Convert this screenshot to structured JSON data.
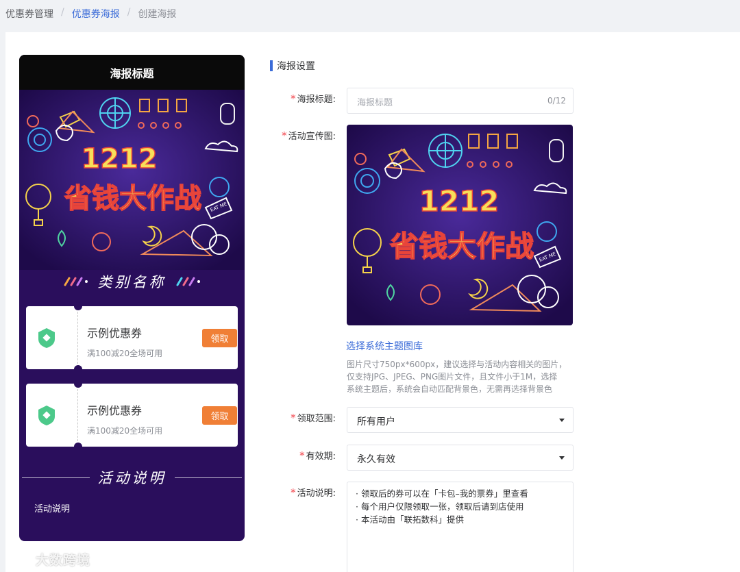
{
  "breadcrumb": {
    "items": [
      "优惠券管理",
      "优惠券海报",
      "创建海报"
    ],
    "separator": "/"
  },
  "poster": {
    "header_title": "海报标题",
    "banner": {
      "line1": "1212",
      "line2": "省钱大作战",
      "sign": "EAT ME"
    },
    "category_title": "类别名称",
    "coupons": [
      {
        "title": "示例优惠券",
        "desc": "满100减20全场可用",
        "button": "领取"
      },
      {
        "title": "示例优惠券",
        "desc": "满100减20全场可用",
        "button": "领取"
      }
    ],
    "activity_title": "活动说明",
    "activity_text": "活动说明"
  },
  "settings": {
    "section_title": "海报设置",
    "fields": {
      "title": {
        "label": "海报标题:",
        "placeholder": "海报标题",
        "counter": "0/12"
      },
      "promo_image": {
        "label": "活动宣传图:"
      },
      "theme_link": "选择系统主题图库",
      "hint_lines": [
        "图片尺寸750px*600px，建议选择与活动内容相关的图片，",
        "仅支持JPG、JPEG、PNG图片文件，且文件小于1M，选择",
        "系统主题后，系统会自动匹配背景色，无需再选择背景色"
      ],
      "scope": {
        "label": "领取范围:",
        "value": "所有用户"
      },
      "validity": {
        "label": "有效期:",
        "value": "永久有效"
      },
      "description": {
        "label": "活动说明:",
        "lines": [
          "· 领取后的券可以在「卡包–我的票券」里查看",
          "· 每个用户仅限领取一张，领取后请到店使用",
          "· 本活动由「联拓数科」提供"
        ]
      }
    }
  },
  "watermark": "大数跨境",
  "colors": {
    "accent": "#3a6bd8",
    "required": "#f2454c",
    "coupon_button": "#f07f36",
    "poster_bg": "#2a0e5c",
    "coupon_icon": "#4cc98a"
  }
}
